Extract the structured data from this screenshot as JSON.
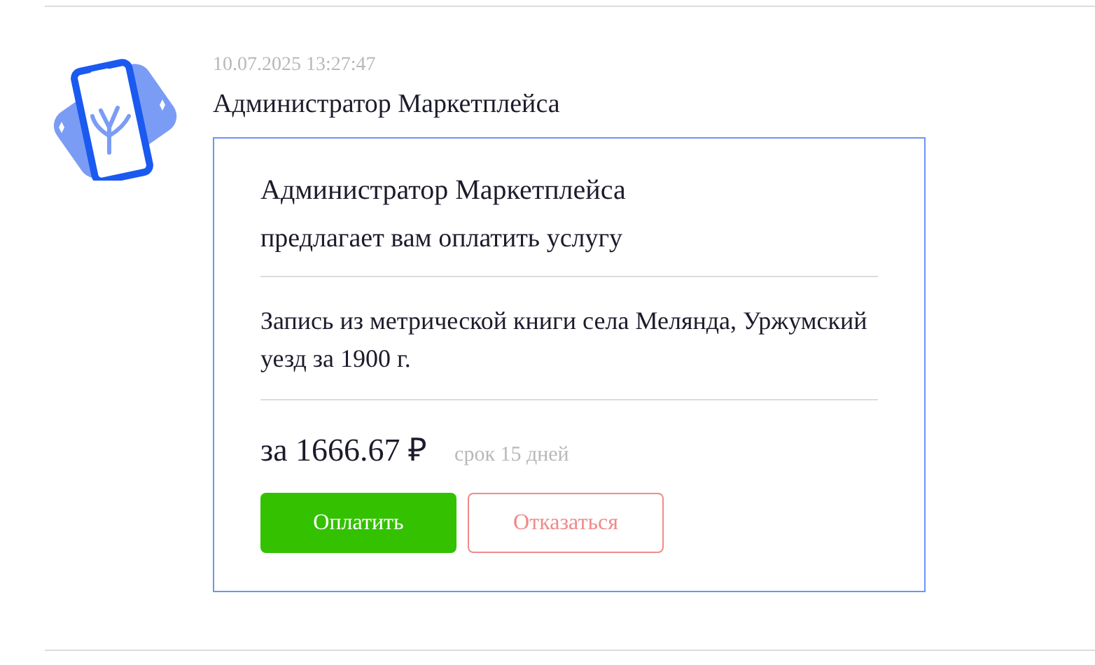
{
  "message": {
    "time": "10.07.2025 13:27:47",
    "sender": "Администратор Маркетплейса"
  },
  "invoice": {
    "from": "Администратор Маркетплейса",
    "subtitle": "предлагает вам оплатить услугу",
    "description": "Запись из метрической книги села Мелянда, Уржумский уезд за 1900 г.",
    "price": "за 1666.67 ₽",
    "term": "срок 15 дней",
    "buttons": [
      {
        "label": "Оплатить",
        "kind": "primary"
      },
      {
        "label": "Отказаться",
        "kind": "secondary"
      }
    ]
  }
}
